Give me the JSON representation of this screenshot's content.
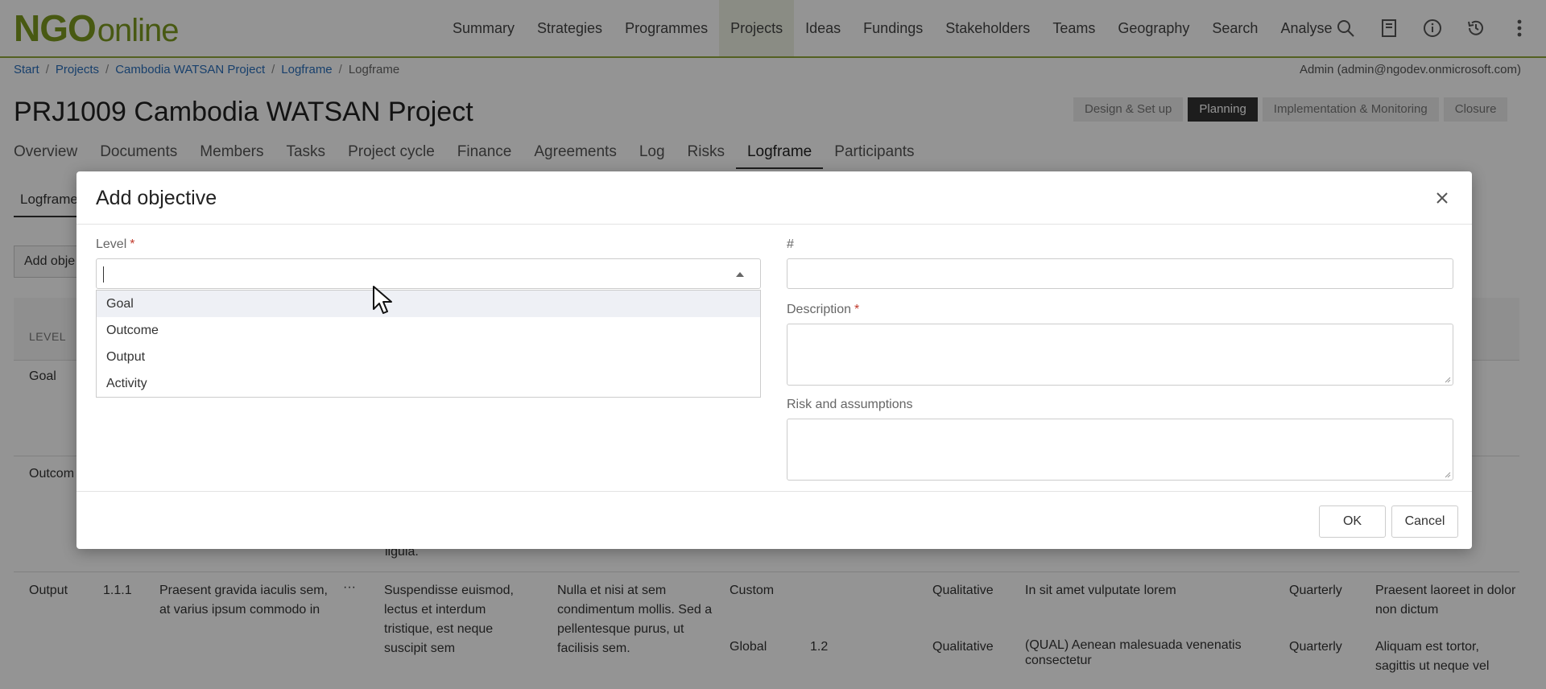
{
  "brand": {
    "logo_main": "NGO",
    "logo_sub": "online"
  },
  "nav": {
    "items": [
      "Summary",
      "Strategies",
      "Programmes",
      "Projects",
      "Ideas",
      "Fundings",
      "Stakeholders",
      "Teams",
      "Geography",
      "Search",
      "Analyse"
    ],
    "active": "Projects",
    "tool_icons": [
      "search-icon",
      "book-icon",
      "info-icon",
      "history-icon",
      "more-vertical-icon"
    ]
  },
  "breadcrumb": {
    "items": [
      "Start",
      "Projects",
      "Cambodia WATSAN Project",
      "Logframe"
    ],
    "current": "Logframe",
    "separator": "/"
  },
  "user": {
    "label": "Admin (admin@ngodev.onmicrosoft.com)"
  },
  "project": {
    "title": "PRJ1009 Cambodia WATSAN Project"
  },
  "phases": {
    "items": [
      "Design & Set up",
      "Planning",
      "Implementation & Monitoring",
      "Closure"
    ],
    "active": "Planning"
  },
  "tabs": {
    "items": [
      "Overview",
      "Documents",
      "Members",
      "Tasks",
      "Project cycle",
      "Finance",
      "Agreements",
      "Log",
      "Risks",
      "Logframe",
      "Participants"
    ],
    "active": "Logframe"
  },
  "subtab": {
    "label": "Logframe"
  },
  "add_button": {
    "label": "Add obje"
  },
  "table": {
    "header_level": "LEVEL",
    "row_labels": [
      "Goal",
      "Outcom"
    ],
    "partial_text": "ligula.",
    "output_row": {
      "level": "Output",
      "code": "1.1.1",
      "description": "Praesent gravida iaculis sem, at varius ipsum commodo in",
      "more": "···",
      "col3": "Suspendisse euismod, lectus et interdum tristique, est neque suscipit sem",
      "col4": "Nulla et nisi at sem condimentum mollis. Sed a pellentesque purus, ut facilisis sem.",
      "indicators": [
        {
          "scope": "Custom",
          "num": "",
          "type": "Qualitative",
          "name": "In sit amet vulputate lorem",
          "freq": "Quarterly",
          "note": "Praesent laoreet in dolor non dictum"
        },
        {
          "scope": "Global",
          "num": "1.2",
          "type": "Qualitative",
          "name": "(QUAL) Aenean malesuada venenatis consectetur",
          "freq": "Quarterly",
          "note": "Aliquam est tortor, sagittis ut neque vel"
        }
      ]
    }
  },
  "modal": {
    "title": "Add objective",
    "level_label": "Level",
    "required_mark": "*",
    "level_value": "",
    "level_options": [
      "Goal",
      "Outcome",
      "Output",
      "Activity"
    ],
    "hovered_option": "Goal",
    "number_label": "#",
    "number_value": "",
    "description_label": "Description",
    "description_value": "",
    "risk_label": "Risk and assumptions",
    "risk_value": "",
    "ok_label": "OK",
    "cancel_label": "Cancel"
  },
  "colors": {
    "brand_green": "#7d9a1f",
    "link_blue": "#2a6ebb",
    "required_red": "#c0392b"
  }
}
